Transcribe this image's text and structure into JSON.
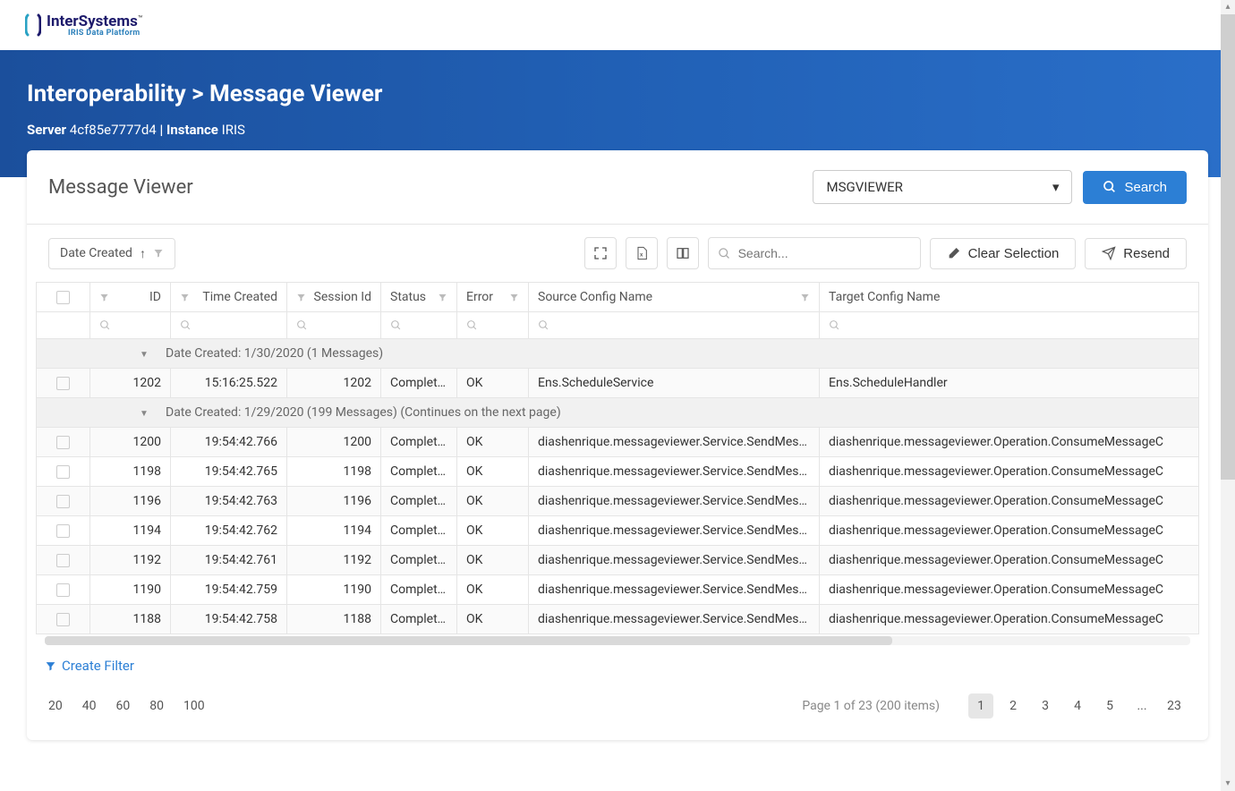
{
  "logo": {
    "brand": "InterSystems",
    "sub": "IRIS Data Platform"
  },
  "breadcrumb": {
    "a": "Interoperability",
    "sep": ">",
    "b": "Message Viewer"
  },
  "server": {
    "label": "Server",
    "value": "4cf85e7777d4",
    "sep": "|",
    "instLabel": "Instance",
    "inst": "IRIS"
  },
  "panel": {
    "title": "Message Viewer"
  },
  "dropdown": {
    "value": "MSGVIEWER"
  },
  "search_button": "Search",
  "sort_chip": "Date Created",
  "search_placeholder": "Search...",
  "clear_selection": "Clear Selection",
  "resend": "Resend",
  "columns": {
    "id": "ID",
    "time": "Time Created",
    "session": "Session Id",
    "status": "Status",
    "error": "Error",
    "source": "Source Config Name",
    "target": "Target Config Name"
  },
  "groups": [
    {
      "label": "Date Created: 1/30/2020 (1 Messages)"
    },
    {
      "label": "Date Created: 1/29/2020 (199 Messages) (Continues on the next page)"
    }
  ],
  "rows": [
    {
      "g": 0,
      "id": "1202",
      "time": "15:16:25.522",
      "session": "1202",
      "status": "Completed",
      "error": "OK",
      "source": "Ens.ScheduleService",
      "target": "Ens.ScheduleHandler"
    },
    {
      "g": 1,
      "id": "1200",
      "time": "19:54:42.766",
      "session": "1200",
      "status": "Completed",
      "error": "OK",
      "source": "diashenrique.messageviewer.Service.SendMessage",
      "target": "diashenrique.messageviewer.Operation.ConsumeMessageC"
    },
    {
      "g": 1,
      "id": "1198",
      "time": "19:54:42.765",
      "session": "1198",
      "status": "Completed",
      "error": "OK",
      "source": "diashenrique.messageviewer.Service.SendMessage",
      "target": "diashenrique.messageviewer.Operation.ConsumeMessageC"
    },
    {
      "g": 1,
      "id": "1196",
      "time": "19:54:42.763",
      "session": "1196",
      "status": "Completed",
      "error": "OK",
      "source": "diashenrique.messageviewer.Service.SendMessage",
      "target": "diashenrique.messageviewer.Operation.ConsumeMessageC"
    },
    {
      "g": 1,
      "id": "1194",
      "time": "19:54:42.762",
      "session": "1194",
      "status": "Completed",
      "error": "OK",
      "source": "diashenrique.messageviewer.Service.SendMessage",
      "target": "diashenrique.messageviewer.Operation.ConsumeMessageC"
    },
    {
      "g": 1,
      "id": "1192",
      "time": "19:54:42.761",
      "session": "1192",
      "status": "Completed",
      "error": "OK",
      "source": "diashenrique.messageviewer.Service.SendMessage",
      "target": "diashenrique.messageviewer.Operation.ConsumeMessageC"
    },
    {
      "g": 1,
      "id": "1190",
      "time": "19:54:42.759",
      "session": "1190",
      "status": "Completed",
      "error": "OK",
      "source": "diashenrique.messageviewer.Service.SendMessage",
      "target": "diashenrique.messageviewer.Operation.ConsumeMessageC"
    },
    {
      "g": 1,
      "id": "1188",
      "time": "19:54:42.758",
      "session": "1188",
      "status": "Completed",
      "error": "OK",
      "source": "diashenrique.messageviewer.Service.SendMessage",
      "target": "diashenrique.messageviewer.Operation.ConsumeMessageC"
    }
  ],
  "create_filter": "Create Filter",
  "page_sizes": [
    "20",
    "40",
    "60",
    "80",
    "100"
  ],
  "pager": {
    "info": "Page 1 of 23 (200 items)",
    "pages": [
      "1",
      "2",
      "3",
      "4",
      "5",
      "...",
      "23"
    ],
    "active": "1"
  }
}
